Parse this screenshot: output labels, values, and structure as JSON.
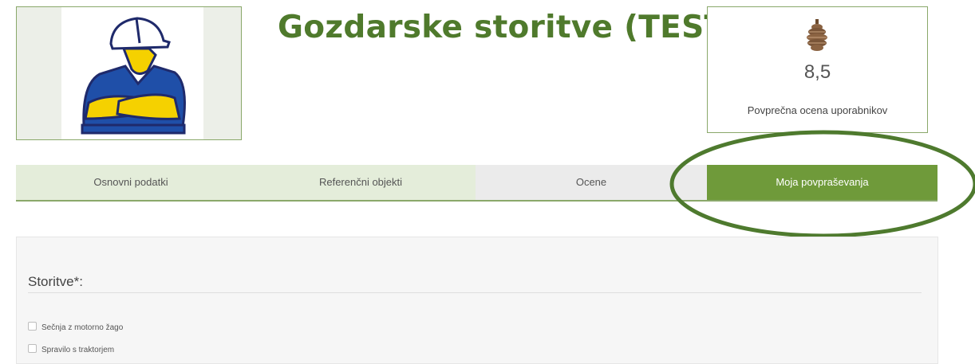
{
  "header": {
    "logo_name": "hard-hat-worker-logo",
    "company_name": "Gozdarske storitve (TEST)"
  },
  "rating": {
    "icon": "pine-cone-icon",
    "value": "8,5",
    "label": "Povprečna ocena uporabnikov"
  },
  "tabs": [
    {
      "label": "Osnovni podatki"
    },
    {
      "label": "Referenčni objekti"
    },
    {
      "label": "Ocene"
    },
    {
      "label": "Moja povpraševanja",
      "active": true
    }
  ],
  "form": {
    "section_title": "Storitve*:",
    "options": [
      {
        "label": "Sečnja z motorno žago",
        "checked": false
      },
      {
        "label": "Spravilo s traktorjem",
        "checked": false
      }
    ]
  },
  "colors": {
    "brand_green": "#4f7a2c",
    "active_tab": "#6f9a3a",
    "inactive_tab": "#e4edda",
    "highlight_ring": "#4e7a2e"
  }
}
